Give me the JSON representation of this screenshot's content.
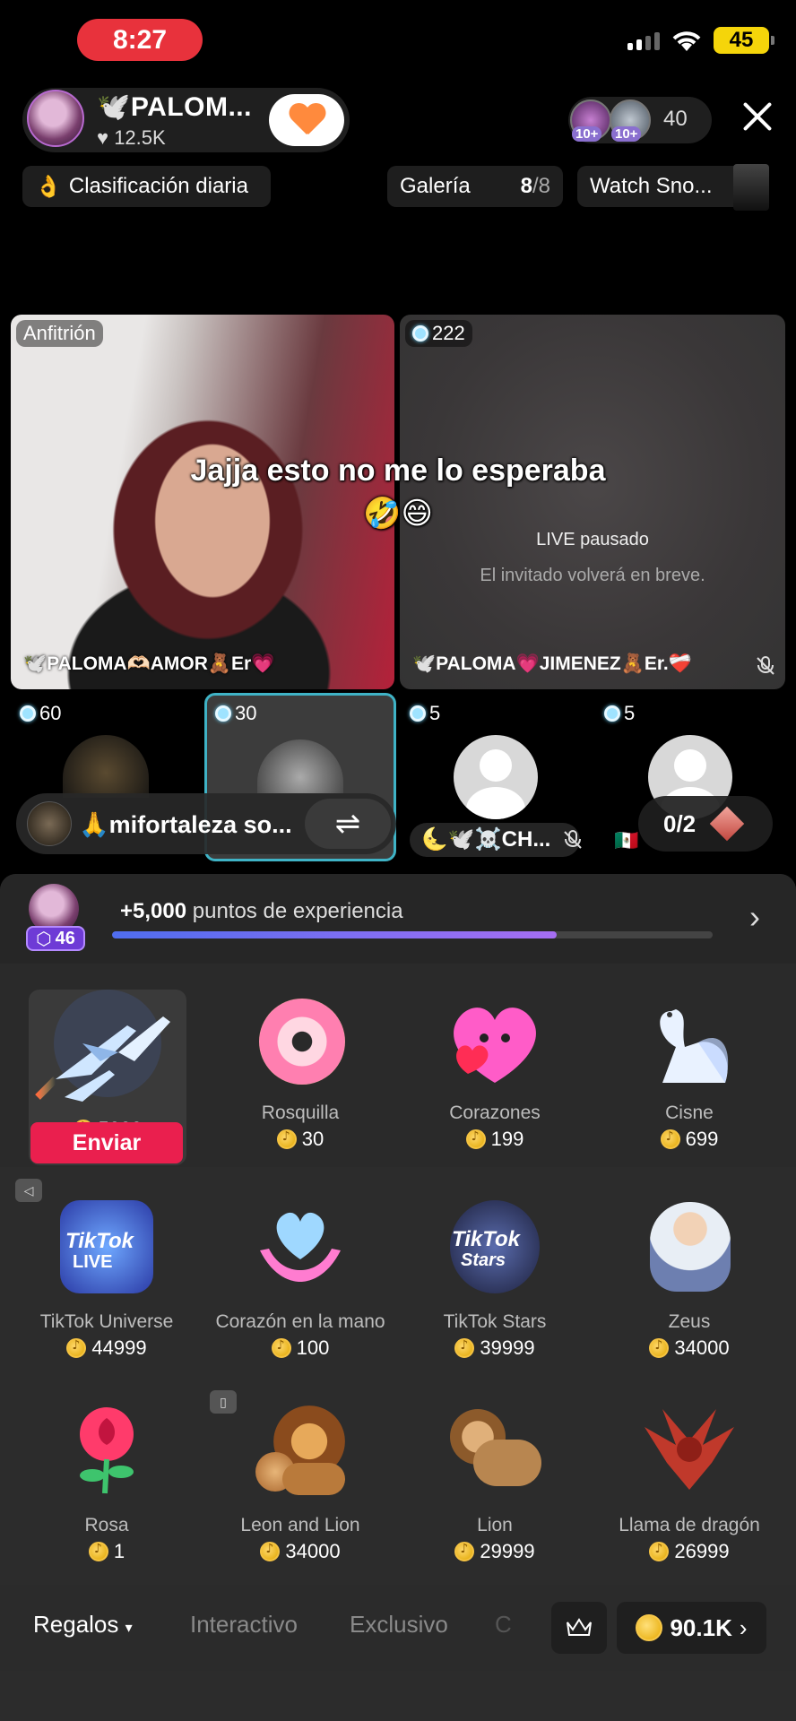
{
  "status_bar": {
    "time": "8:27",
    "battery": "45"
  },
  "host": {
    "name": "🕊️PALOM...",
    "likes": "12.5K"
  },
  "viewers": {
    "count": "40",
    "badge_1": "10+",
    "badge_2": "10+"
  },
  "chips": {
    "ranking": "Clasificación diaria",
    "gallery_label": "Galería",
    "gallery_count": "8",
    "gallery_total": "/8",
    "watch": "Watch Sno..."
  },
  "video": {
    "host_tag": "Anfitrión",
    "host_name": "🕊️PALOMA🫶🏻AMOR🧸Er💗",
    "guest_score": "222",
    "guest_name": "🕊️PALOMA💗JIMENEZ🧸Er.❤️‍🩹",
    "paused_title": "LIVE pausado",
    "paused_sub": "El invitado volverá en breve.",
    "overlay_line1": "Jajja esto no me lo esperaba",
    "overlay_line2": "🤣😄"
  },
  "small_tiles": [
    {
      "score": "60"
    },
    {
      "score": "30"
    },
    {
      "score": "5"
    },
    {
      "score": "5"
    }
  ],
  "co_host": {
    "name": "🙏mifortaleza so...",
    "swap_icon": "⇌"
  },
  "ch_user": {
    "name": "🌜🕊️☠️CH..."
  },
  "battle": {
    "score": "0/2"
  },
  "experience": {
    "level": "46",
    "amount": "+5,000",
    "label": "puntos de experiencia",
    "progress": 0.74
  },
  "selected_gift": {
    "price": "5000",
    "send_label": "Enviar"
  },
  "gifts_row1": [
    {
      "name": "Rosquilla",
      "price": "30"
    },
    {
      "name": "Corazones",
      "price": "199"
    },
    {
      "name": "Cisne",
      "price": "699"
    }
  ],
  "gifts_row2": [
    {
      "name": "TikTok Universe",
      "price": "44999"
    },
    {
      "name": "Corazón en la mano",
      "price": "100"
    },
    {
      "name": "TikTok Stars",
      "price": "39999"
    },
    {
      "name": "Zeus",
      "price": "34000"
    }
  ],
  "gifts_row3": [
    {
      "name": "Rosa",
      "price": "1"
    },
    {
      "name": "Leon and Lion",
      "price": "34000"
    },
    {
      "name": "Lion",
      "price": "29999"
    },
    {
      "name": "Llama de dragón",
      "price": "26999"
    }
  ],
  "tabs": {
    "gifts": "Regalos",
    "interactive": "Interactivo",
    "exclusive": "Exclusivo",
    "more": "C"
  },
  "wallet": {
    "coins": "90.1K"
  }
}
